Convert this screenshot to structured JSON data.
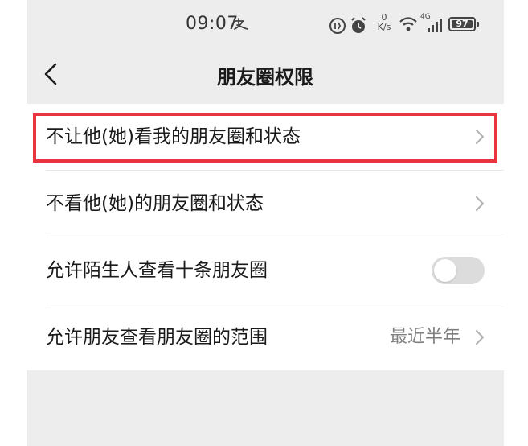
{
  "status_bar": {
    "time": "09:07",
    "network_speed_value": "0",
    "network_speed_unit": "K/s",
    "signal_label": "4G",
    "battery": "97",
    "icons": [
      "alipay-icon",
      "data-saver-icon",
      "alarm-icon",
      "wifi-icon",
      "cellular-signal-icon",
      "battery-icon"
    ]
  },
  "nav": {
    "title": "朋友圈权限",
    "back_icon": "chevron-left-icon"
  },
  "settings": {
    "items": [
      {
        "label": "不让他(她)看我的朋友圈和状态",
        "control": "chevron"
      },
      {
        "label": "不看他(她)的朋友圈和状态",
        "control": "chevron"
      },
      {
        "label": "允许陌生人查看十条朋友圈",
        "control": "toggle",
        "toggle_on": false
      },
      {
        "label": "允许朋友查看朋友圈的范围",
        "control": "chevron",
        "value": "最近半年"
      }
    ]
  },
  "colors": {
    "background": "#ededed",
    "list_background": "#ffffff",
    "highlight": "#e8343d",
    "secondary_text": "#7f7f7f",
    "toggle_off": "#dcdcdc"
  }
}
